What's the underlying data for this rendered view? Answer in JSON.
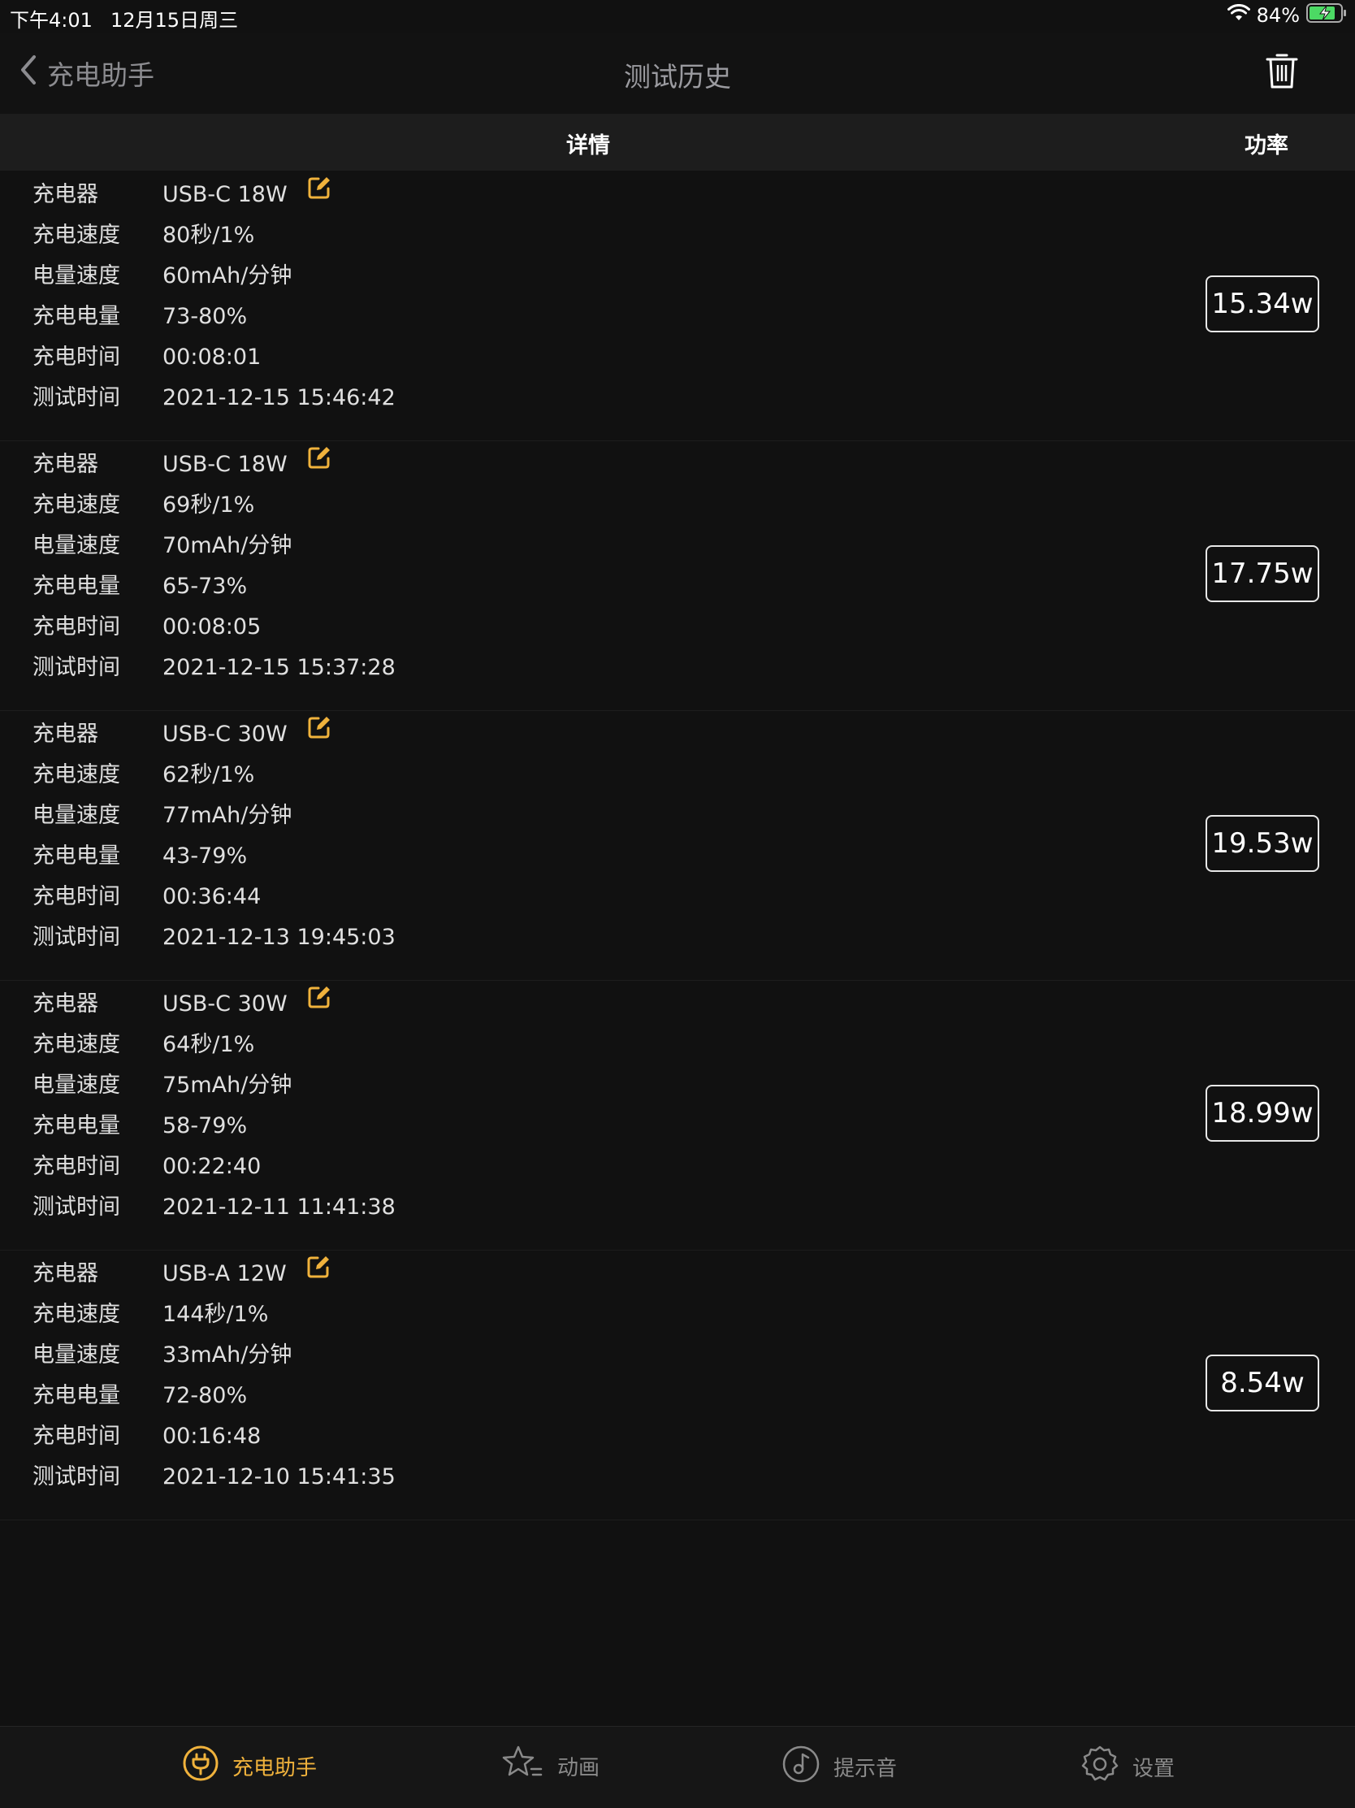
{
  "status_bar": {
    "time": "下午4:01",
    "date": "12月15日周三",
    "battery_percent": "84%",
    "icons": [
      "wifi-icon",
      "battery-charging-icon"
    ]
  },
  "nav": {
    "back_label": "充电助手",
    "title": "测试历史",
    "icons": [
      "chevron-left-icon",
      "trash-icon"
    ]
  },
  "table_header": {
    "details": "详情",
    "power": "功率"
  },
  "labels": {
    "charger": "充电器",
    "charge_speed": "充电速度",
    "capacity_speed": "电量速度",
    "charge_amount": "充电电量",
    "charge_time": "充电时间",
    "test_time": "测试时间"
  },
  "records": [
    {
      "charger": "USB-C 18W",
      "charge_speed": "80秒/1%",
      "capacity_speed": "60mAh/分钟",
      "charge_amount": "73-80%",
      "charge_time": "00:08:01",
      "test_time": "2021-12-15 15:46:42",
      "power": "15.34w"
    },
    {
      "charger": "USB-C 18W",
      "charge_speed": "69秒/1%",
      "capacity_speed": "70mAh/分钟",
      "charge_amount": "65-73%",
      "charge_time": "00:08:05",
      "test_time": "2021-12-15 15:37:28",
      "power": "17.75w"
    },
    {
      "charger": "USB-C 30W",
      "charge_speed": "62秒/1%",
      "capacity_speed": "77mAh/分钟",
      "charge_amount": "43-79%",
      "charge_time": "00:36:44",
      "test_time": "2021-12-13 19:45:03",
      "power": "19.53w"
    },
    {
      "charger": "USB-C 30W",
      "charge_speed": "64秒/1%",
      "capacity_speed": "75mAh/分钟",
      "charge_amount": "58-79%",
      "charge_time": "00:22:40",
      "test_time": "2021-12-11 11:41:38",
      "power": "18.99w"
    },
    {
      "charger": "USB-A 12W",
      "charge_speed": "144秒/1%",
      "capacity_speed": "33mAh/分钟",
      "charge_amount": "72-80%",
      "charge_time": "00:16:48",
      "test_time": "2021-12-10 15:41:35",
      "power": "8.54w"
    }
  ],
  "tabs": [
    {
      "label": "充电助手",
      "icon": "plug-icon",
      "active": true
    },
    {
      "label": "动画",
      "icon": "star-list-icon",
      "active": false
    },
    {
      "label": "提示音",
      "icon": "music-disc-icon",
      "active": false
    },
    {
      "label": "设置",
      "icon": "gear-icon",
      "active": false
    }
  ],
  "colors": {
    "accent": "#f0b23c",
    "background": "#111111",
    "header_background": "#1d1d1d"
  }
}
